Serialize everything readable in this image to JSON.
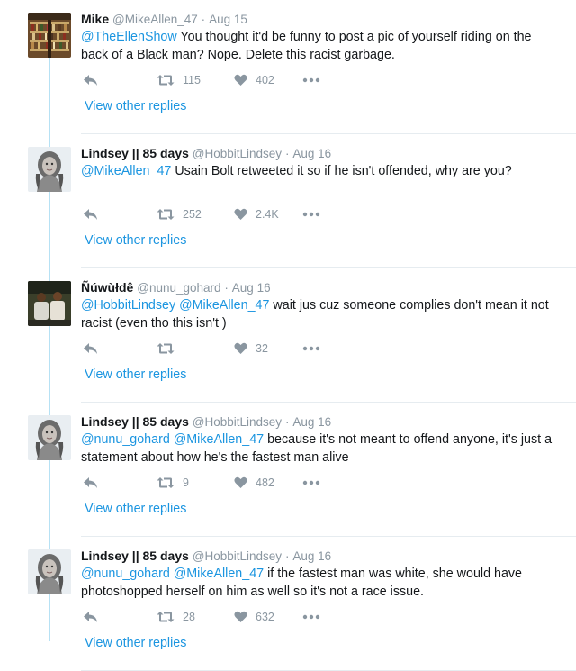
{
  "tweets": [
    {
      "name": "Mike",
      "handle": "@MikeAllen_47",
      "date": "Aug 15",
      "mentions": "@TheEllenShow",
      "text": "You thought it'd be funny to post a pic of yourself riding on the back of a Black man? Nope. Delete this racist garbage.",
      "retweets": "115",
      "likes": "402",
      "view_replies": "View other replies",
      "avatar": "library-shelves"
    },
    {
      "name": "Lindsey || 85 days",
      "handle": "@HobbitLindsey",
      "date": "Aug 16",
      "mentions": "@MikeAllen_47",
      "text": "Usain Bolt retweeted it so if he isn't offended, why are you?",
      "retweets": "252",
      "likes": "2.4K",
      "view_replies": "View other replies",
      "avatar": "woman-portrait"
    },
    {
      "name": "Ñúwùłdê",
      "handle": "@nunu_gohard",
      "date": "Aug 16",
      "mentions": "@HobbitLindsey @MikeAllen_47",
      "text": "wait jus cuz someone complies don't mean it not racist (even tho this isn't )",
      "retweets": "",
      "likes": "32",
      "view_replies": "View other replies",
      "avatar": "two-people"
    },
    {
      "name": "Lindsey || 85 days",
      "handle": "@HobbitLindsey",
      "date": "Aug 16",
      "mentions": "@nunu_gohard @MikeAllen_47",
      "text": "because it's not meant to offend anyone, it's just a statement about how he's the fastest man alive",
      "retweets": "9",
      "likes": "482",
      "view_replies": "View other replies",
      "avatar": "woman-portrait"
    },
    {
      "name": "Lindsey || 85 days",
      "handle": "@HobbitLindsey",
      "date": "Aug 16",
      "mentions": "@nunu_gohard @MikeAllen_47",
      "text": "if the fastest man was white, she would have photoshopped herself on him as well so it's not a race issue.",
      "retweets": "28",
      "likes": "632",
      "view_replies": "View other replies",
      "avatar": "woman-portrait"
    }
  ],
  "colors": {
    "link": "#1b95e0",
    "muted": "#8a96a0",
    "thread_line": "#b6e1f4",
    "separator": "#e6ecf0"
  },
  "icons": {
    "reply": "reply-arrow-icon",
    "retweet": "retweet-icon",
    "like": "heart-icon",
    "more": "more-dots-icon"
  }
}
